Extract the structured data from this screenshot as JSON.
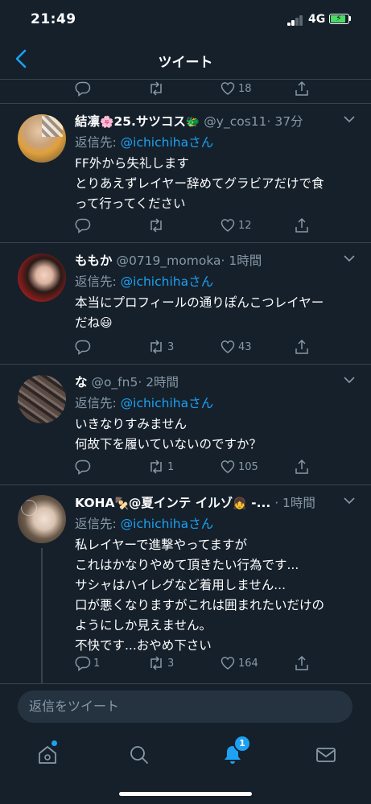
{
  "status": {
    "time": "21:49",
    "network": "4G"
  },
  "nav": {
    "title": "ツイート"
  },
  "partial_tweet": {
    "like_count": "18"
  },
  "tweets": [
    {
      "name": "結凛",
      "name_suffix": "25.サツコス",
      "handle": "@y_cos11",
      "time": "· 37分",
      "reply_label": "返信先: ",
      "reply_mention": "@ichichihaさん",
      "lines": [
        "FF外から失礼します",
        "とりあえずレイヤー辞めてグラビアだけで食",
        "って行ってください"
      ],
      "reply_count": "",
      "retweet_count": "",
      "like_count": "12"
    },
    {
      "name": "ももか",
      "handle": "@0719_momoka",
      "time": "· 1時間",
      "reply_label": "返信先: ",
      "reply_mention": "@ichichihaさん",
      "lines": [
        "本当にプロフィールの通りぽんこつレイヤー",
        "だね"
      ],
      "reply_count": "",
      "retweet_count": "3",
      "like_count": "43"
    },
    {
      "name": "な",
      "handle": "@o_fn5",
      "time": "· 2時間",
      "reply_label": "返信先: ",
      "reply_mention": "@ichichihaさん",
      "lines": [
        "いきなりすみません",
        "何故下を履いていないのですか？"
      ],
      "reply_count": "",
      "retweet_count": "1",
      "like_count": "105"
    },
    {
      "name": "KOHA",
      "name_suffix": "@夏インテ イルゾ",
      "name_tail": " -...",
      "handle": "",
      "time": "· 1時間",
      "reply_label": "返信先: ",
      "reply_mention": "@ichichihaさん",
      "lines": [
        "私レイヤーで進撃やってますが",
        "これはかなりやめて頂きたい行為です...",
        "サシャはハイレグなど着用しません...",
        "口が悪くなりますがこれは囲まれたいだけの",
        "ようにしか見えません。",
        "不快です...おやめ下さい"
      ],
      "reply_count": "1",
      "retweet_count": "3",
      "like_count": "164"
    }
  ],
  "reply_box": {
    "placeholder": "返信をツイート"
  },
  "tabs": {
    "notifications_badge": "1"
  },
  "colors": {
    "background": "#15202b",
    "accent": "#1da1f2",
    "muted": "#8899a6",
    "divider": "#38444d"
  }
}
